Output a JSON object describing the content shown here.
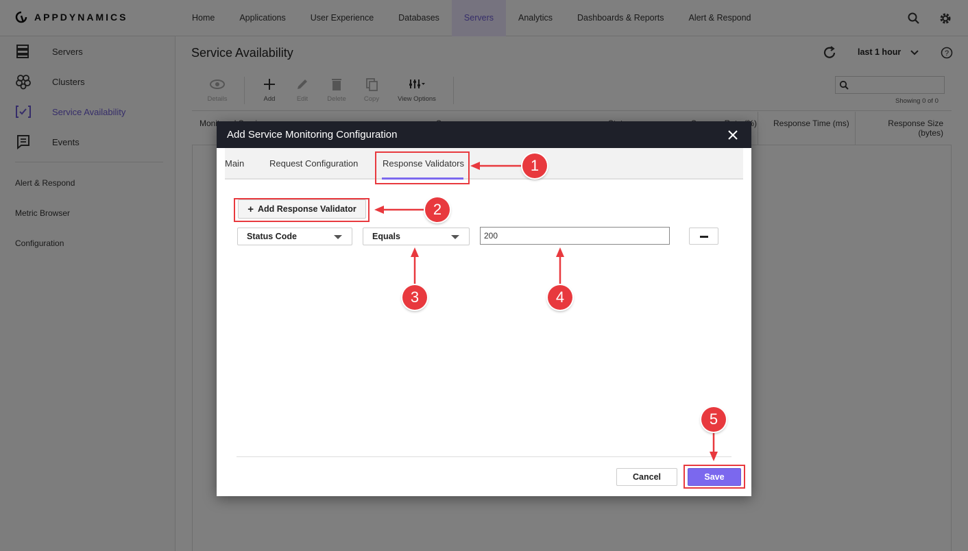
{
  "brand": {
    "name": "APPDYNAMICS"
  },
  "nav": {
    "items": [
      "Home",
      "Applications",
      "User Experience",
      "Databases",
      "Servers",
      "Analytics",
      "Dashboards & Reports",
      "Alert & Respond"
    ],
    "active": "Servers"
  },
  "sidebar": {
    "items": [
      {
        "label": "Servers",
        "icon": "servers-icon"
      },
      {
        "label": "Clusters",
        "icon": "clusters-icon"
      },
      {
        "label": "Service Availability",
        "icon": "service-availability-icon",
        "active": true
      },
      {
        "label": "Events",
        "icon": "events-icon"
      }
    ],
    "links": [
      "Alert & Respond",
      "Metric Browser",
      "Configuration"
    ]
  },
  "page": {
    "title": "Service Availability",
    "time_range": "last 1 hour",
    "toolbar": {
      "details": "Details",
      "add": "Add",
      "edit": "Edit",
      "delete": "Delete",
      "copy": "Copy",
      "view_options": "View Options"
    },
    "showing": "Showing 0 of 0",
    "table": {
      "columns": [
        "Monitored Service",
        "Server",
        "Status",
        "Success Rate (%)",
        "Response Time (ms)",
        "Response Size (bytes)"
      ]
    }
  },
  "modal": {
    "title": "Add Service Monitoring Configuration",
    "tabs": [
      "Main",
      "Request Configuration",
      "Response Validators"
    ],
    "active_tab": "Response Validators",
    "add_validator_label": "Add Response Validator",
    "validator": {
      "field": "Status Code",
      "operator": "Equals",
      "value": "200"
    },
    "cancel_label": "Cancel",
    "save_label": "Save"
  },
  "annotations": {
    "callouts": [
      "1",
      "2",
      "3",
      "4",
      "5"
    ],
    "color": "#e8393e"
  },
  "colors": {
    "accent": "#7b68ee",
    "modal_header": "#1e2029"
  }
}
